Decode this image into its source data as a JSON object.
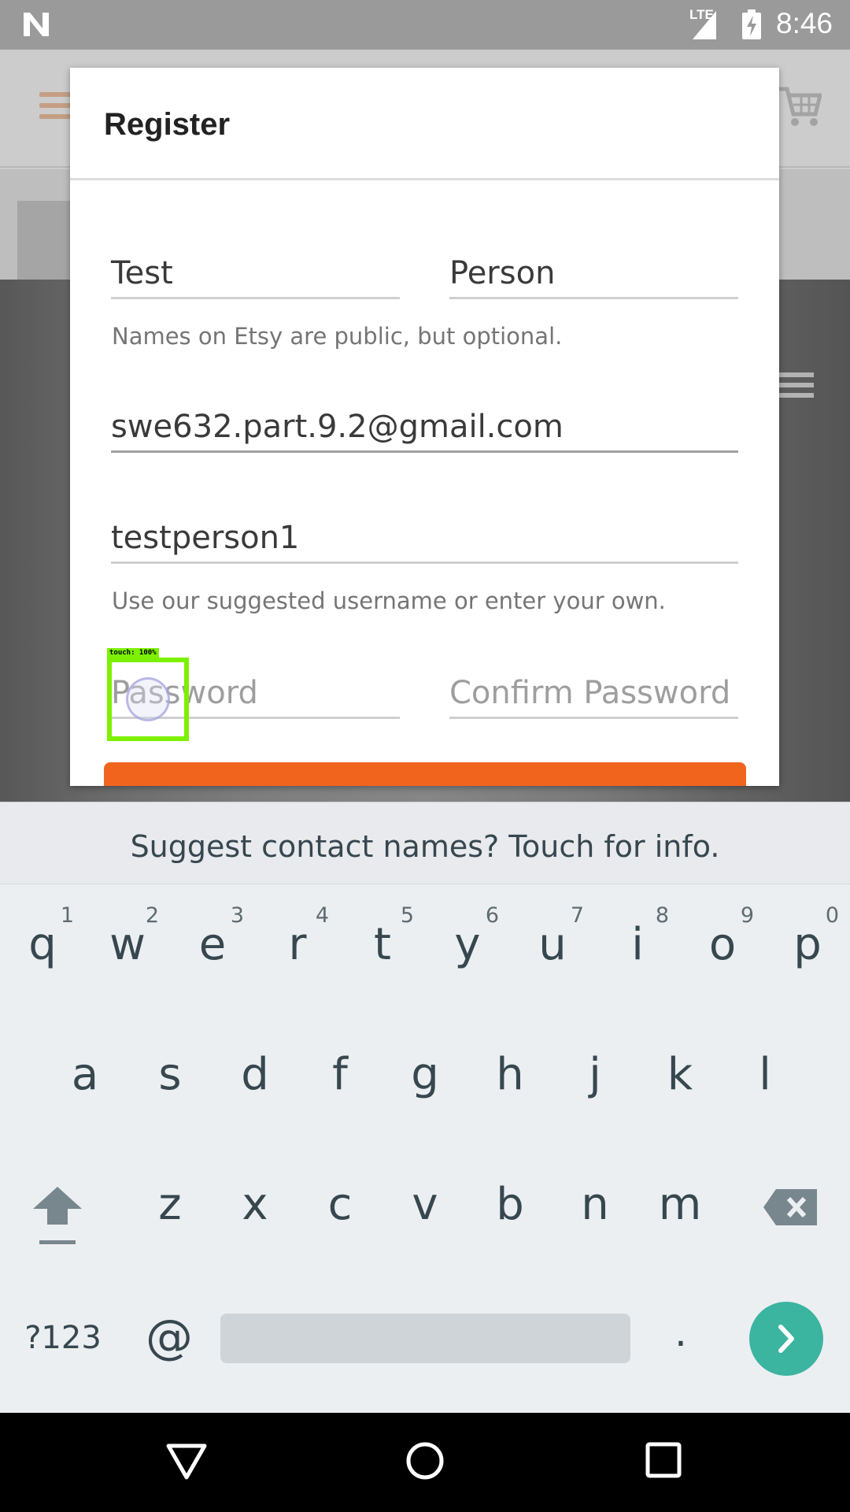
{
  "status_bar": {
    "network": "LTE",
    "time": "8:46",
    "icons": [
      "n-logo-icon",
      "signal-icon",
      "battery-charging-icon"
    ]
  },
  "background_app": {
    "icons": [
      "menu-icon",
      "cart-icon",
      "list-view-icon"
    ]
  },
  "dialog": {
    "title": "Register",
    "first_name": {
      "value": "Test"
    },
    "last_name": {
      "value": "Person"
    },
    "names_hint": "Names on Etsy are public, but optional.",
    "email": {
      "value": "swe632.part.9.2@gmail.com"
    },
    "username": {
      "value": "testperson1"
    },
    "username_hint": "Use our suggested username or enter your own.",
    "password": {
      "placeholder": "Password",
      "value": ""
    },
    "confirm_password": {
      "placeholder": "Confirm Password",
      "value": ""
    },
    "button_color": "#f1641e"
  },
  "touch_indicator": {
    "label": "touch: 100%",
    "color": "#7cf000"
  },
  "keyboard": {
    "suggestion": "Suggest contact names? Touch for info.",
    "row1": [
      {
        "letter": "q",
        "hint": "1"
      },
      {
        "letter": "w",
        "hint": "2"
      },
      {
        "letter": "e",
        "hint": "3"
      },
      {
        "letter": "r",
        "hint": "4"
      },
      {
        "letter": "t",
        "hint": "5"
      },
      {
        "letter": "y",
        "hint": "6"
      },
      {
        "letter": "u",
        "hint": "7"
      },
      {
        "letter": "i",
        "hint": "8"
      },
      {
        "letter": "o",
        "hint": "9"
      },
      {
        "letter": "p",
        "hint": "0"
      }
    ],
    "row2": [
      "a",
      "s",
      "d",
      "f",
      "g",
      "h",
      "j",
      "k",
      "l"
    ],
    "row3": [
      "z",
      "x",
      "c",
      "v",
      "b",
      "n",
      "m"
    ],
    "symbols_label": "?123",
    "at_label": "@",
    "period_label": ".",
    "accent_color": "#3bb4a0"
  },
  "nav_bar": {
    "icons": [
      "back-icon",
      "home-icon",
      "recents-icon"
    ]
  }
}
